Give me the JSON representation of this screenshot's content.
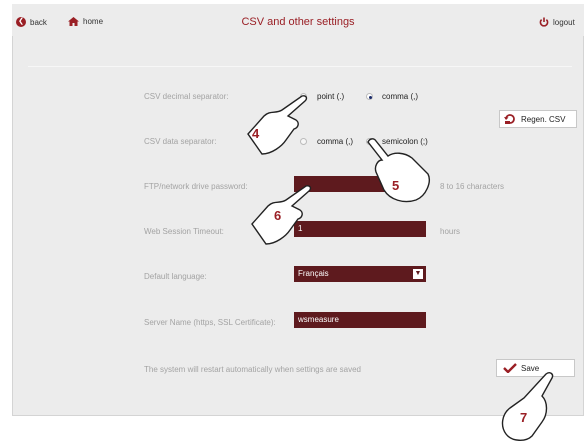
{
  "header": {
    "back_label": "back",
    "home_label": "home",
    "title": "CSV and other settings",
    "logout_label": "logout"
  },
  "settings": {
    "decimal_separator": {
      "label": "CSV decimal separator:",
      "options": [
        "point (.)",
        "comma (,)"
      ],
      "selected": "comma (,)"
    },
    "data_separator": {
      "label": "CSV data separator:",
      "options": [
        "comma (,)",
        "semicolon (;)"
      ],
      "selected": "semicolon (;)"
    },
    "ftp_password": {
      "label": "FTP/network drive password:",
      "value": "",
      "hint": "8 to 16 characters"
    },
    "session_timeout": {
      "label": "Web Session Timeout:",
      "value": "1",
      "unit": "hours"
    },
    "language": {
      "label": "Default language:",
      "value": "Français"
    },
    "server_name": {
      "label": "Server Name (https, SSL Certificate):",
      "value": "wsmeasure"
    },
    "restart_note": "The system will restart automatically when settings are saved"
  },
  "buttons": {
    "regen_csv": "Regen. CSV",
    "save": "Save"
  },
  "callouts": [
    "4",
    "5",
    "6",
    "7"
  ],
  "colors": {
    "accent": "#9a1f25",
    "field_bg": "#5e1a1e",
    "panel_bg": "#ececec"
  }
}
